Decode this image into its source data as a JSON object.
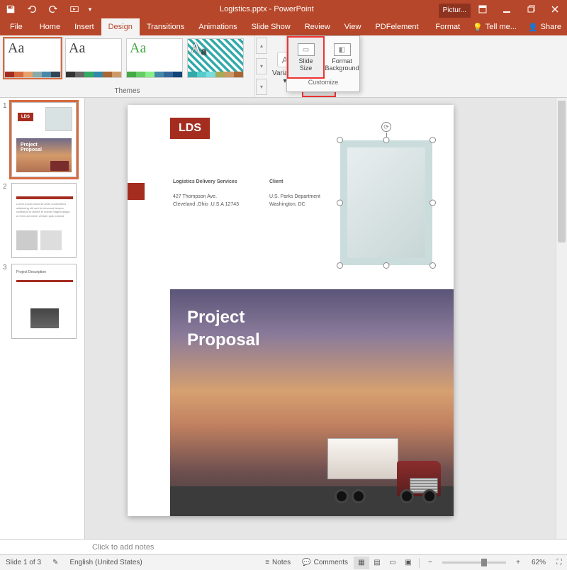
{
  "window": {
    "title": "Logistics.pptx - PowerPoint",
    "context_tab": "Pictur..."
  },
  "tabs": {
    "file": "File",
    "home": "Home",
    "insert": "Insert",
    "design": "Design",
    "transitions": "Transitions",
    "animations": "Animations",
    "slideshow": "Slide Show",
    "review": "Review",
    "view": "View",
    "pdf": "PDFelement",
    "format": "Format",
    "tellme": "Tell me...",
    "share": "Share"
  },
  "ribbon": {
    "themes_label": "Themes",
    "variants_label": "Variants",
    "customize_label": "Customize"
  },
  "customize_popup": {
    "slide_size": "Slide\nSize",
    "format_bg": "Format\nBackground",
    "group": "Customize"
  },
  "slide": {
    "logo": "LDS",
    "company_header": "Logistics Delivery Services",
    "addr1": "427 Thompson Ave.",
    "addr2": "Cleveland ,Ohio ,U.S.A 12743",
    "client_header": "Client",
    "client1": "U.S. Parks Department",
    "client2": "Washington, DC",
    "title1": "Project",
    "title2": "Proposal"
  },
  "thumbs": {
    "n1": "1",
    "n2": "2",
    "n3": "3",
    "t1_logo": "LDS",
    "t1_title": "Project\nProposal",
    "t3_title": "Project Description"
  },
  "notes": {
    "placeholder": "Click to add notes"
  },
  "status": {
    "slide": "Slide 1 of 3",
    "lang": "English (United States)",
    "notes": "Notes",
    "comments": "Comments",
    "zoom": "62%"
  }
}
